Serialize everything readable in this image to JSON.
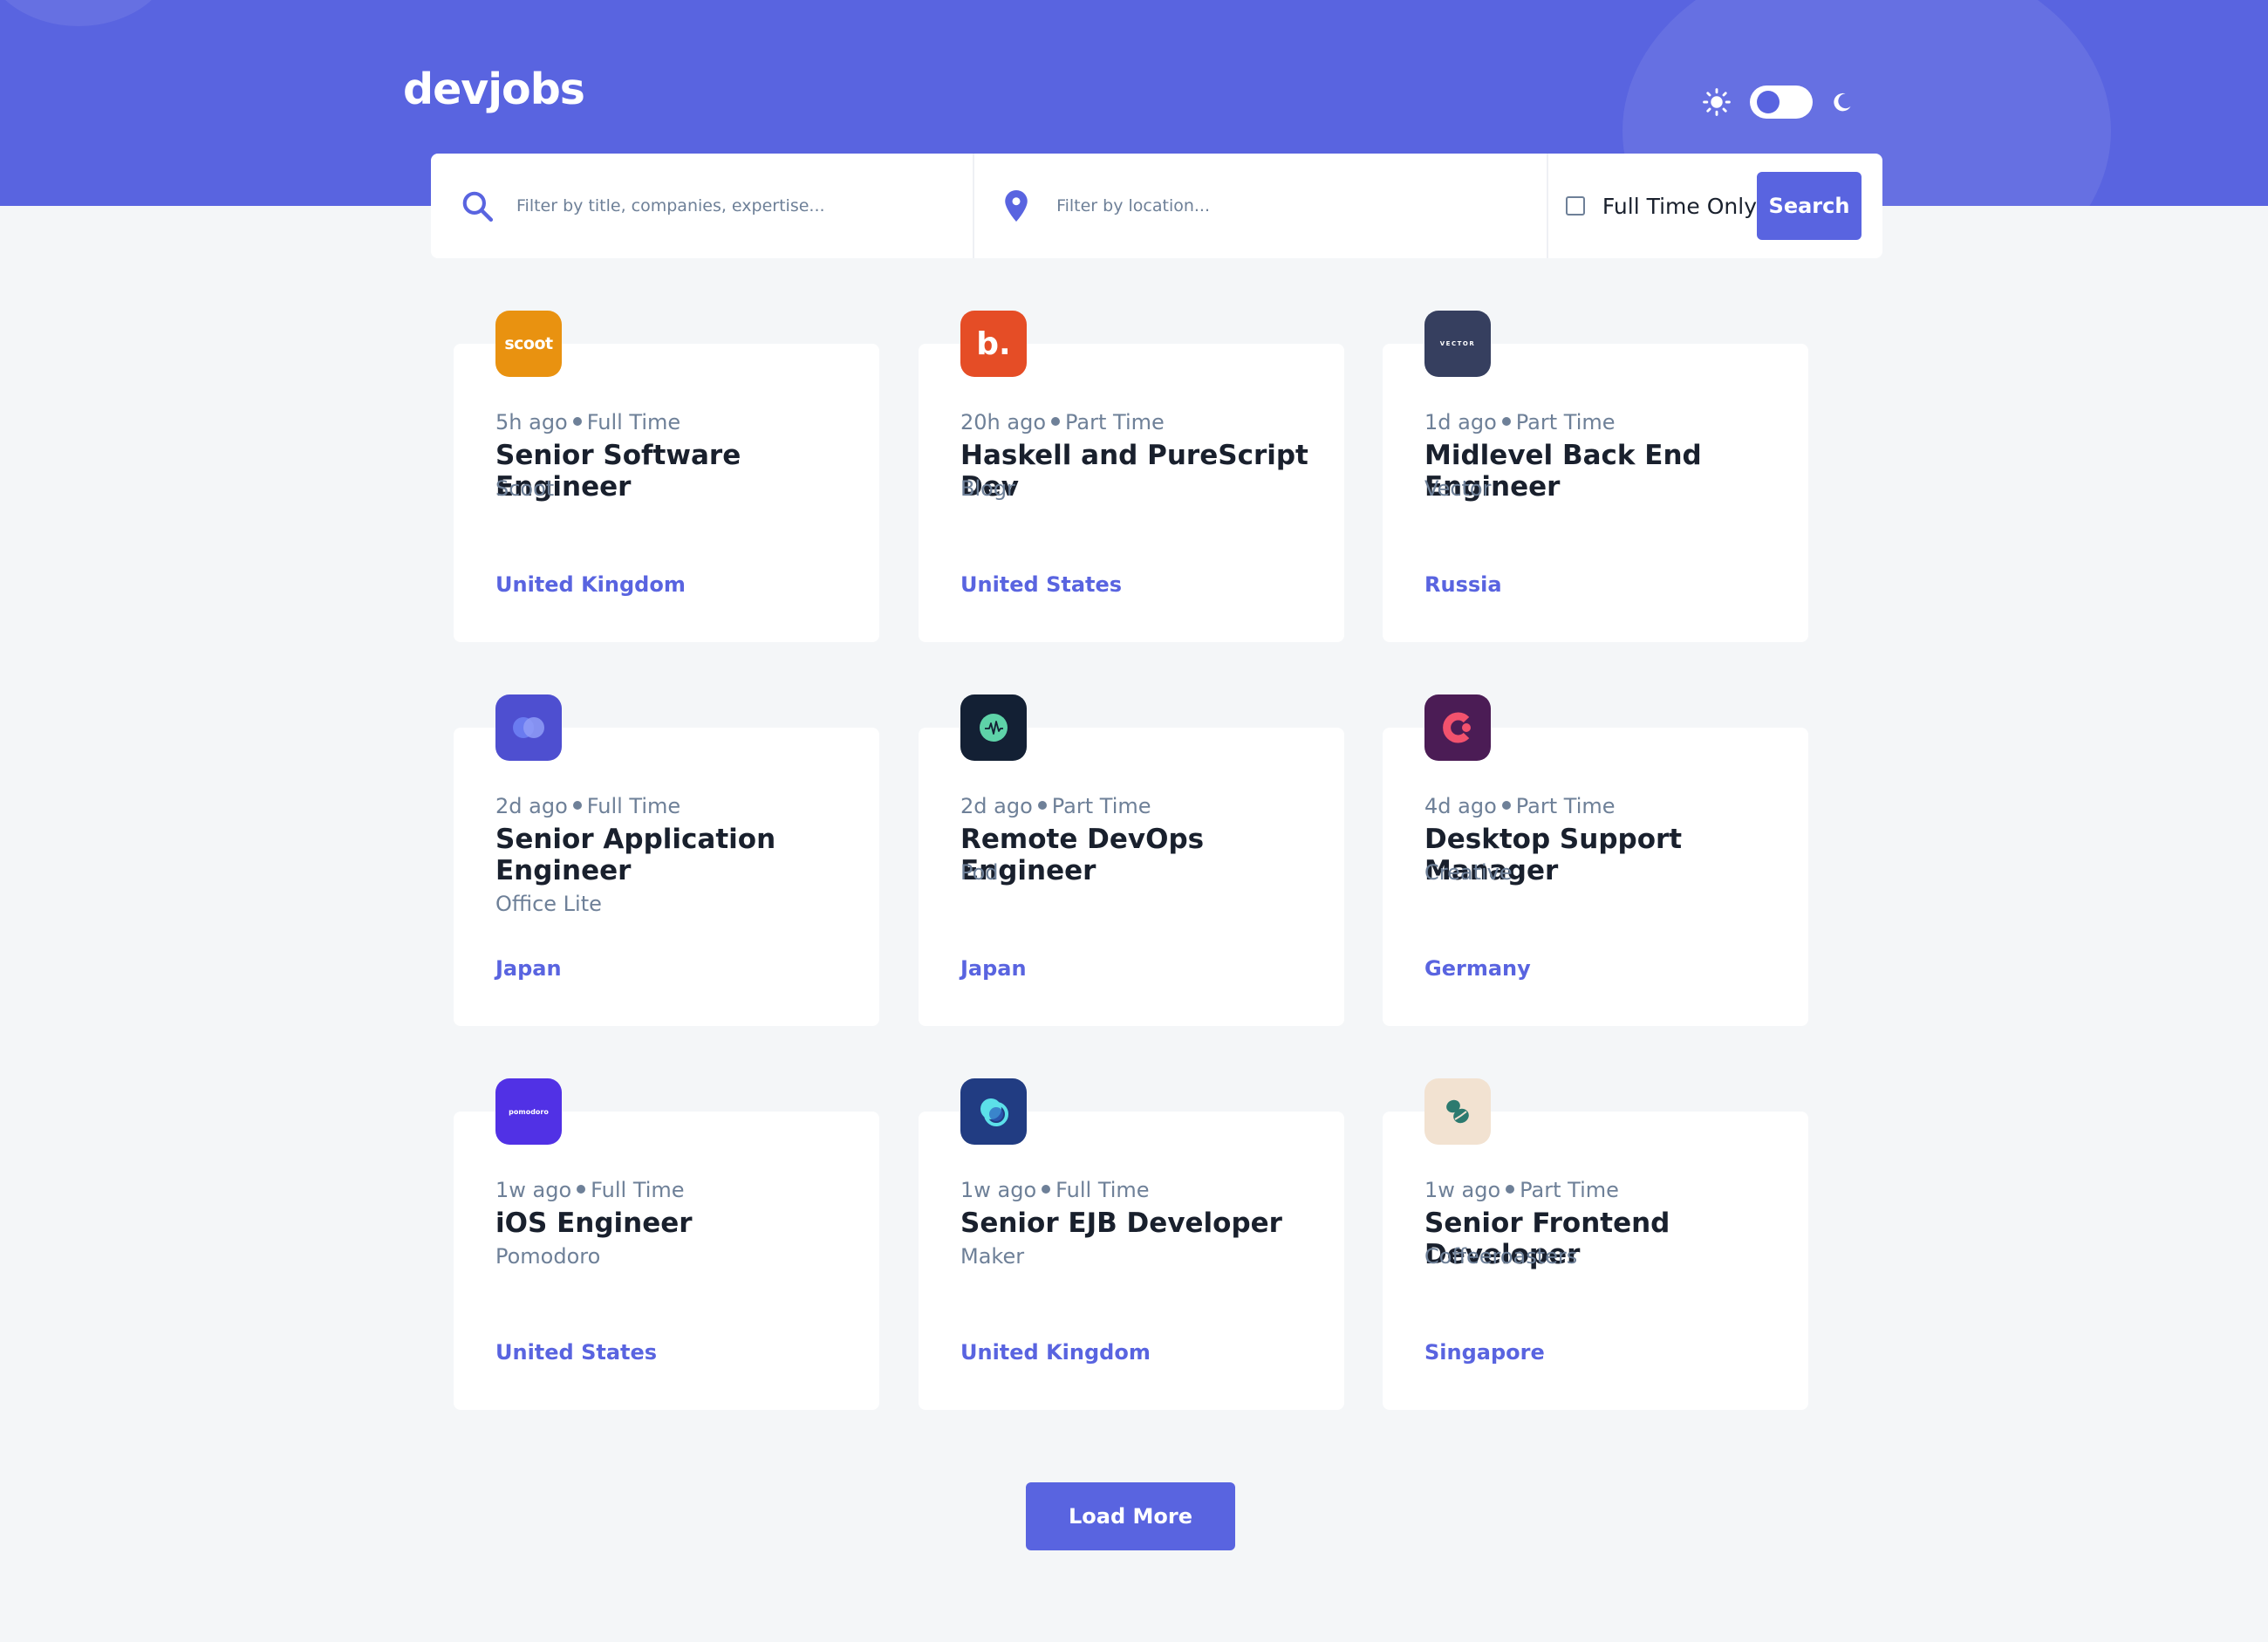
{
  "brand": {
    "logo_text": "devjobs"
  },
  "theme_toggle": {
    "light_icon": "sun-icon",
    "dark_icon": "moon-icon"
  },
  "search": {
    "title_placeholder": "Filter by title, companies, expertise...",
    "location_placeholder": "Filter by location...",
    "fulltime_label": "Full Time Only",
    "search_label": "Search"
  },
  "colors": {
    "accent": "#5964E0",
    "background": "#F4F6F8",
    "text_dark": "#19202D",
    "text_muted": "#6E8098"
  },
  "jobs": [
    {
      "posted": "5h ago",
      "contract": "Full Time",
      "title": "Senior Software Engineer",
      "company": "Scoot",
      "location": "United Kingdom",
      "logo_text": "scoot",
      "logo_color": "#E99210"
    },
    {
      "posted": "20h ago",
      "contract": "Part Time",
      "title": "Haskell and PureScript Dev",
      "company": "Blogr",
      "location": "United States",
      "logo_text": "b.",
      "logo_color": "#E54D26"
    },
    {
      "posted": "1d ago",
      "contract": "Part Time",
      "title": "Midlevel Back End Engineer",
      "company": "Vector",
      "location": "Russia",
      "logo_text": "VECTOR",
      "logo_color": "#363F5F"
    },
    {
      "posted": "2d ago",
      "contract": "Full Time",
      "title": "Senior Application Engineer",
      "company": "Office Lite",
      "location": "Japan",
      "logo_text": "",
      "logo_color": "#4E4FD0"
    },
    {
      "posted": "2d ago",
      "contract": "Part Time",
      "title": "Remote DevOps Engineer",
      "company": "Pod",
      "location": "Japan",
      "logo_text": "",
      "logo_color": "#132034"
    },
    {
      "posted": "4d ago",
      "contract": "Part Time",
      "title": "Desktop Support Manager",
      "company": "Creative",
      "location": "Germany",
      "logo_text": "",
      "logo_color": "#4B1C55"
    },
    {
      "posted": "1w ago",
      "contract": "Full Time",
      "title": "iOS Engineer",
      "company": "Pomodoro",
      "location": "United States",
      "logo_text": "pomodoro",
      "logo_color": "#5131E5"
    },
    {
      "posted": "1w ago",
      "contract": "Full Time",
      "title": "Senior EJB Developer",
      "company": "Maker",
      "location": "United Kingdom",
      "logo_text": "",
      "logo_color": "#213C82"
    },
    {
      "posted": "1w ago",
      "contract": "Part Time",
      "title": "Senior Frontend Developer",
      "company": "Coffeeroasters",
      "location": "Singapore",
      "logo_text": "",
      "logo_color": "#F2E2D1"
    }
  ],
  "load_more_label": "Load More"
}
